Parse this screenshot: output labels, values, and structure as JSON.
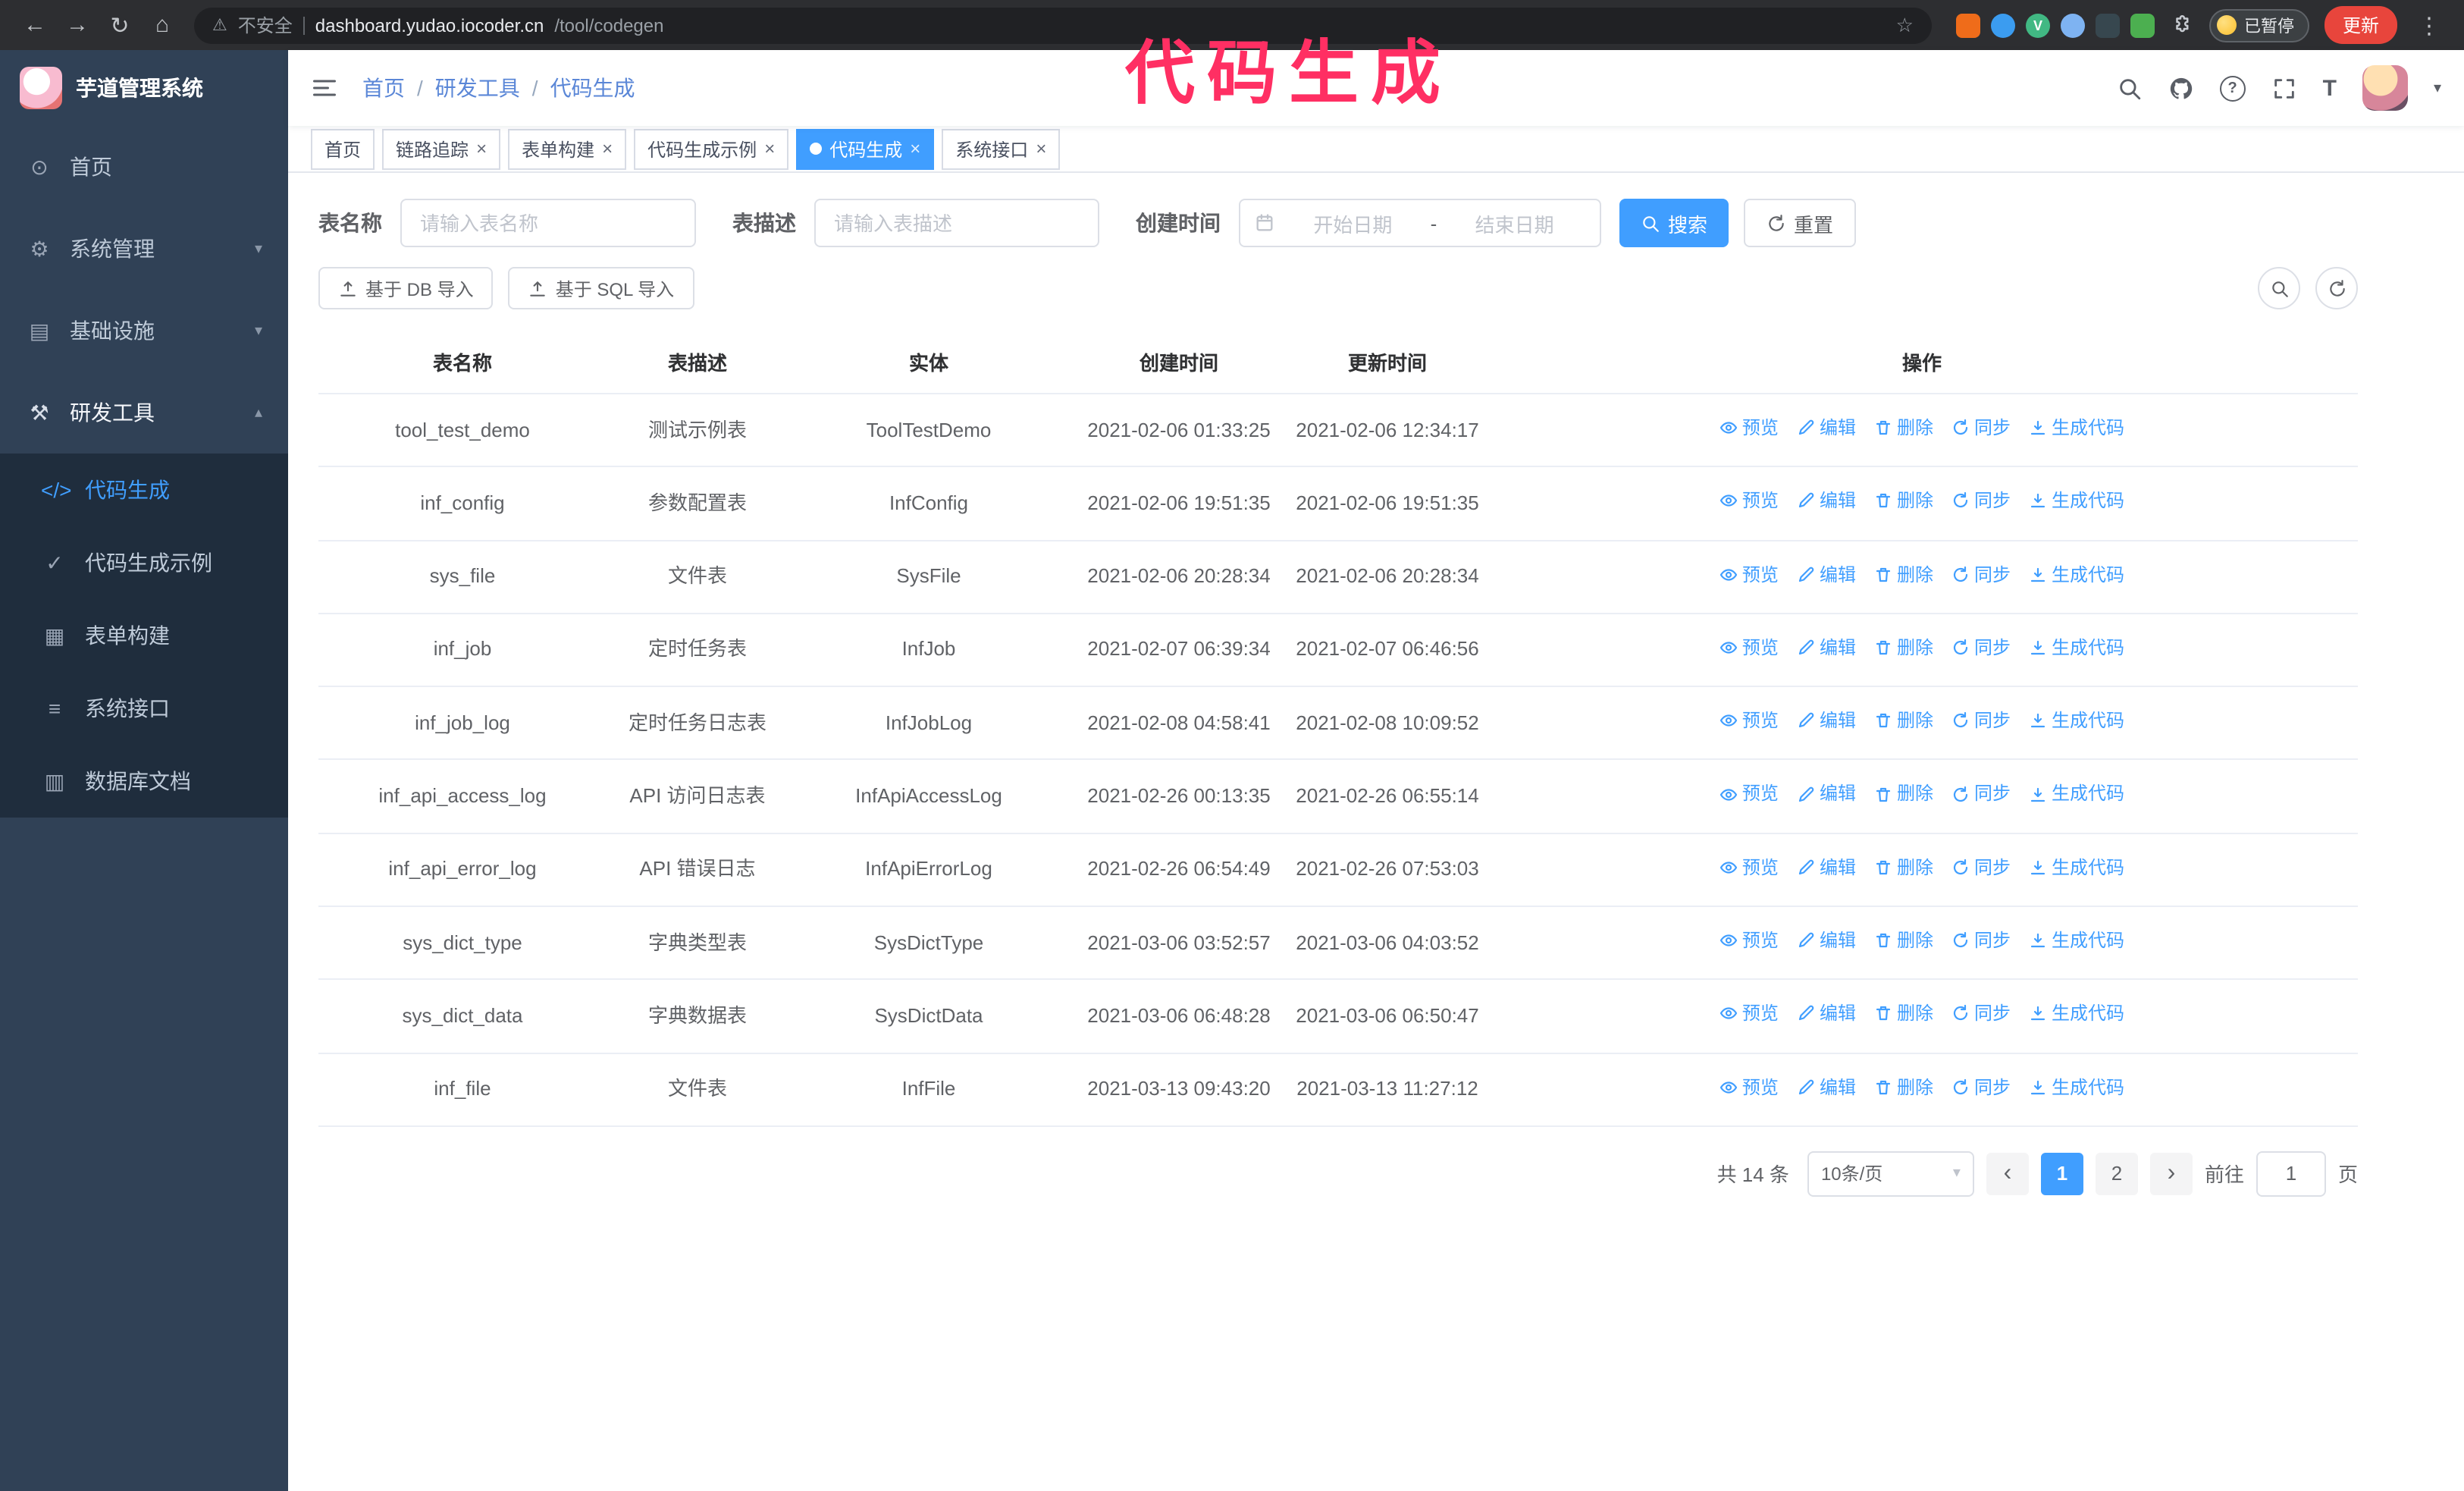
{
  "annotation": {
    "text": "代码生成",
    "color": "#ff2f63"
  },
  "colors": {
    "accent": "#409eff",
    "sidebar_bg": "#304156",
    "submenu_bg": "#1f2d3d",
    "update_button": "#e8453c"
  },
  "icons": {
    "back-icon": "←",
    "forward-icon": "→",
    "reload-icon": "↻",
    "home-icon": "⌂",
    "warning-icon": "⚠",
    "star-icon": "☆",
    "kebab-icon": "⋮",
    "close-icon": "×",
    "question-icon": "?",
    "font-size-icon": "T",
    "caret-down-icon": "▾",
    "chevron-down": "▾",
    "chevron-up": "▴",
    "prev-icon": "‹",
    "next-icon": "›",
    "dashboard-icon": "⊙",
    "system-icon": "⚙",
    "infra-icon": "▤",
    "devtools-icon": "⚒",
    "codegen-icon": "</>",
    "example-icon": "✓",
    "form-builder-icon": "▦",
    "api-icon": "≡",
    "db-doc-icon": "▥"
  },
  "browser": {
    "security_label": "不安全",
    "url_host": "dashboard.yudao.iocoder.cn",
    "url_path": "/tool/codegen",
    "paused_badge": "已暂停",
    "update_button": "更新",
    "extensions": [
      {
        "key": "fox",
        "color": "#ef6c1a",
        "shape": "square",
        "letter": ""
      },
      {
        "key": "drop",
        "color": "#3b9cf0",
        "shape": "circle",
        "letter": ""
      },
      {
        "key": "vue-devtools",
        "color": "#41b883",
        "shape": "circle",
        "letter": "V"
      },
      {
        "key": "people",
        "color": "#7eb3f2",
        "shape": "circle",
        "letter": ""
      },
      {
        "key": "dev-dark",
        "color": "#37474f",
        "shape": "square",
        "letter": ""
      },
      {
        "key": "green-tool",
        "color": "#4caf50",
        "shape": "square",
        "letter": ""
      }
    ]
  },
  "sidebar": {
    "app_title": "芋道管理系统",
    "menu": [
      {
        "key": "home",
        "label": "首页",
        "icon": "dashboard-icon"
      },
      {
        "key": "system",
        "label": "系统管理",
        "icon": "system-icon",
        "chevron": "down"
      },
      {
        "key": "infra",
        "label": "基础设施",
        "icon": "infra-icon",
        "chevron": "down"
      },
      {
        "key": "devtools",
        "label": "研发工具",
        "icon": "devtools-icon",
        "chevron": "up",
        "expanded": true,
        "children": [
          {
            "key": "codegen",
            "label": "代码生成",
            "icon": "codegen-icon",
            "active": true
          },
          {
            "key": "codegen-example",
            "label": "代码生成示例",
            "icon": "example-icon"
          },
          {
            "key": "form-builder",
            "label": "表单构建",
            "icon": "form-builder-icon"
          },
          {
            "key": "api",
            "label": "系统接口",
            "icon": "api-icon"
          },
          {
            "key": "db-doc",
            "label": "数据库文档",
            "icon": "db-doc-icon"
          }
        ]
      }
    ]
  },
  "navbar": {
    "breadcrumb": [
      "首页",
      "研发工具",
      "代码生成"
    ],
    "separator": "/"
  },
  "tabs": [
    {
      "key": "home",
      "label": "首页",
      "closable": false
    },
    {
      "key": "tracer",
      "label": "链路追踪",
      "closable": true
    },
    {
      "key": "form-builder",
      "label": "表单构建",
      "closable": true
    },
    {
      "key": "codegen-example",
      "label": "代码生成示例",
      "closable": true
    },
    {
      "key": "codegen",
      "label": "代码生成",
      "closable": true,
      "active": true
    },
    {
      "key": "api",
      "label": "系统接口",
      "closable": true
    }
  ],
  "filters": {
    "table_name_label": "表名称",
    "table_name_placeholder": "请输入表名称",
    "table_desc_label": "表描述",
    "table_desc_placeholder": "请输入表描述",
    "create_time_label": "创建时间",
    "date_start_placeholder": "开始日期",
    "date_separator": "-",
    "date_end_placeholder": "结束日期",
    "search_button": "搜索",
    "reset_button": "重置"
  },
  "toolbar": {
    "import_db": "基于 DB 导入",
    "import_sql": "基于 SQL 导入"
  },
  "table": {
    "columns": [
      "表名称",
      "表描述",
      "实体",
      "创建时间",
      "更新时间",
      "操作"
    ],
    "row_actions": [
      {
        "key": "preview",
        "label": "预览",
        "icon": "eye"
      },
      {
        "key": "edit",
        "label": "编辑",
        "icon": "edit"
      },
      {
        "key": "delete",
        "label": "删除",
        "icon": "trash"
      },
      {
        "key": "sync",
        "label": "同步",
        "icon": "sync"
      },
      {
        "key": "generate-code",
        "label": "生成代码",
        "icon": "download"
      }
    ],
    "rows": [
      {
        "name": "tool_test_demo",
        "desc": "测试示例表",
        "entity": "ToolTestDemo",
        "created": "2021-02-06 01:33:25",
        "updated": "2021-02-06 12:34:17"
      },
      {
        "name": "inf_config",
        "desc": "参数配置表",
        "entity": "InfConfig",
        "created": "2021-02-06 19:51:35",
        "updated": "2021-02-06 19:51:35"
      },
      {
        "name": "sys_file",
        "desc": "文件表",
        "entity": "SysFile",
        "created": "2021-02-06 20:28:34",
        "updated": "2021-02-06 20:28:34"
      },
      {
        "name": "inf_job",
        "desc": "定时任务表",
        "entity": "InfJob",
        "created": "2021-02-07 06:39:34",
        "updated": "2021-02-07 06:46:56"
      },
      {
        "name": "inf_job_log",
        "desc": "定时任务日志表",
        "entity": "InfJobLog",
        "created": "2021-02-08 04:58:41",
        "updated": "2021-02-08 10:09:52"
      },
      {
        "name": "inf_api_access_log",
        "desc": "API 访问日志表",
        "entity": "InfApiAccessLog",
        "created": "2021-02-26 00:13:35",
        "updated": "2021-02-26 06:55:14"
      },
      {
        "name": "inf_api_error_log",
        "desc": "API 错误日志",
        "entity": "InfApiErrorLog",
        "created": "2021-02-26 06:54:49",
        "updated": "2021-02-26 07:53:03"
      },
      {
        "name": "sys_dict_type",
        "desc": "字典类型表",
        "entity": "SysDictType",
        "created": "2021-03-06 03:52:57",
        "updated": "2021-03-06 04:03:52"
      },
      {
        "name": "sys_dict_data",
        "desc": "字典数据表",
        "entity": "SysDictData",
        "created": "2021-03-06 06:48:28",
        "updated": "2021-03-06 06:50:47"
      },
      {
        "name": "inf_file",
        "desc": "文件表",
        "entity": "InfFile",
        "created": "2021-03-13 09:43:20",
        "updated": "2021-03-13 11:27:12"
      }
    ]
  },
  "pagination": {
    "total": "共 14 条",
    "page_size": "10条/页",
    "pages": [
      "1",
      "2"
    ],
    "current": "1",
    "goto_label": "前往",
    "goto_value": "1",
    "goto_suffix": "页"
  }
}
